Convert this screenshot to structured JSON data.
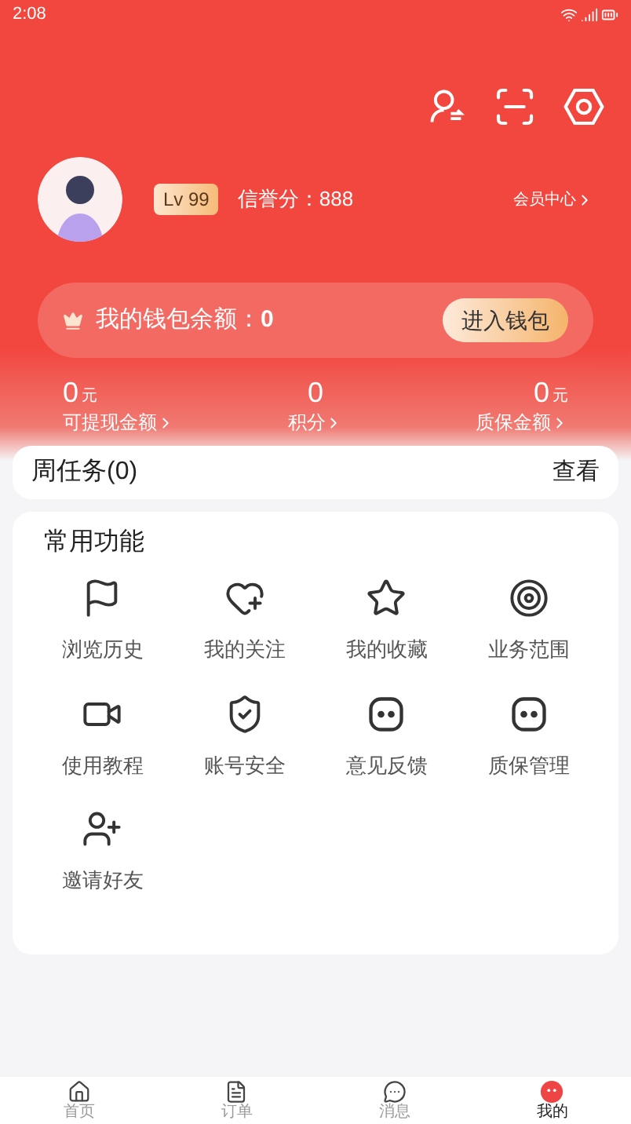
{
  "status_bar": {
    "time": "2:08"
  },
  "profile": {
    "level": "Lv 99",
    "credit": "信誉分：888",
    "member_link": "会员中心"
  },
  "wallet": {
    "label": "我的钱包余额：**0**",
    "button": "进入钱包"
  },
  "stats": [
    {
      "value": "0",
      "unit": "元",
      "label": "可提现金额"
    },
    {
      "value": "0",
      "label": "积分"
    },
    {
      "value": "0",
      "unit": "元",
      "label": "质保金额"
    }
  ],
  "weekly_task": {
    "title": "周任务(0)",
    "action": "查看"
  },
  "functions": {
    "title": "常用功能",
    "items": [
      {
        "kind": "flag",
        "label": "浏览历史"
      },
      {
        "kind": "heart",
        "label": "我的关注"
      },
      {
        "kind": "star",
        "label": "我的收藏"
      },
      {
        "kind": "target",
        "label": "业务范围"
      },
      {
        "kind": "video",
        "label": "使用教程"
      },
      {
        "kind": "shield",
        "label": "账号安全"
      },
      {
        "kind": "chat",
        "label": "意见反馈"
      },
      {
        "kind": "chat",
        "label": "质保管理"
      },
      {
        "kind": "invite",
        "label": "邀请好友"
      }
    ]
  },
  "bottom_nav": [
    {
      "kind": "home",
      "label": "首页",
      "selected": false
    },
    {
      "kind": "order",
      "label": "订单",
      "selected": false
    },
    {
      "kind": "message",
      "label": "消息",
      "selected": false
    },
    {
      "kind": "mine",
      "label": "我的",
      "selected": true
    }
  ]
}
